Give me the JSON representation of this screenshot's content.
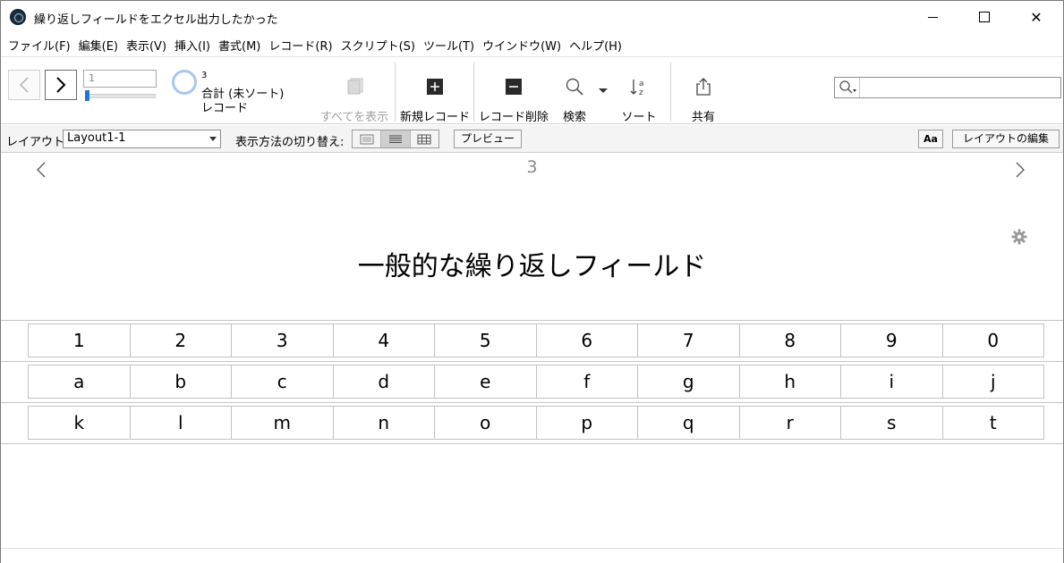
{
  "window": {
    "title": "繰り返しフィールドをエクセル出力したかった",
    "min_label": "",
    "max_label": "",
    "close_label": "✕"
  },
  "menu": [
    "ファイル(F)",
    "編集(E)",
    "表示(V)",
    "挿入(I)",
    "書式(M)",
    "レコード(R)",
    "スクリプト(S)",
    "ツール(T)",
    "ウインドウ(W)",
    "ヘルプ(H)"
  ],
  "toolbar": {
    "record_number": "1",
    "record_progress": 0.0,
    "found_count": "3",
    "total_label": "合計 (未ソート)",
    "unit_label": "レコード",
    "show_all": "すべてを表示",
    "new_record": "新規レコード",
    "delete_record": "レコード削除",
    "find": "検索",
    "sort": "ソート",
    "share": "共有",
    "search_value": ""
  },
  "layoutbar": {
    "layout_label": "レイアウト:",
    "layout_value": "Layout1-1",
    "view_label": "表示方法の切り替え:",
    "active_view": "list",
    "preview": "プレビュー",
    "aa": "Aa",
    "edit_layout": "レイアウトの編集"
  },
  "content": {
    "record_number": "3",
    "heading": "一般的な繰り返しフィールド",
    "rows": [
      [
        "1",
        "2",
        "3",
        "4",
        "5",
        "6",
        "7",
        "8",
        "9",
        "0"
      ],
      [
        "a",
        "b",
        "c",
        "d",
        "e",
        "f",
        "g",
        "h",
        "i",
        "j"
      ],
      [
        "k",
        "l",
        "m",
        "n",
        "o",
        "p",
        "q",
        "r",
        "s",
        "t"
      ]
    ]
  }
}
